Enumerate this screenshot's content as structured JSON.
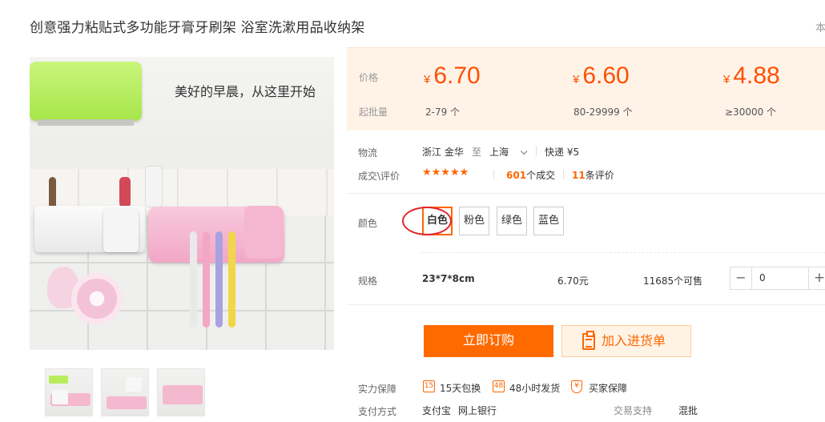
{
  "product": {
    "title": "创意强力粘贴式多功能牙膏牙刷架 浴室洗漱用品收纳架",
    "corner_text": "本",
    "image_slogan": "美好的早晨，从这里开始"
  },
  "pricing": {
    "price_label": "价格",
    "moq_label": "起批量",
    "currency": "¥",
    "tiers": [
      {
        "price": "6.70",
        "range": "2-79 个"
      },
      {
        "price": "6.60",
        "range": "80-29999 个"
      },
      {
        "price": "4.88",
        "range": "≥30000 个"
      }
    ]
  },
  "logistics": {
    "label": "物流",
    "origin": "浙江 金华",
    "to": "至",
    "destination": "上海",
    "shipping": "快递 ¥5"
  },
  "reviews": {
    "label": "成交\\评价",
    "stars": "★★★★★",
    "deals_count": "601",
    "deals_suffix": "个成交",
    "reviews_count": "11",
    "reviews_suffix": "条评价"
  },
  "colors": {
    "label": "颜色",
    "options": [
      "白色",
      "粉色",
      "绿色",
      "蓝色"
    ],
    "selected_index": 0
  },
  "spec": {
    "label": "规格",
    "name": "23*7*8cm",
    "price": "6.70元",
    "stock": "11685个可售",
    "quantity": "0",
    "minus": "−",
    "plus": "+"
  },
  "actions": {
    "buy_now": "立即订购",
    "add_to_cart": "加入进货单"
  },
  "guarantee": {
    "label": "实力保障",
    "items": [
      {
        "icon": "15",
        "text": "15天包换"
      },
      {
        "icon": "48",
        "text": "48小时发货"
      },
      {
        "icon": "¥",
        "text": "买家保障"
      }
    ]
  },
  "payment": {
    "label": "支付方式",
    "methods": [
      "支付宝",
      "网上银行"
    ],
    "trade_support_label": "交易支持",
    "trade_support_value": "混批"
  },
  "accent_color": "#ff6600"
}
